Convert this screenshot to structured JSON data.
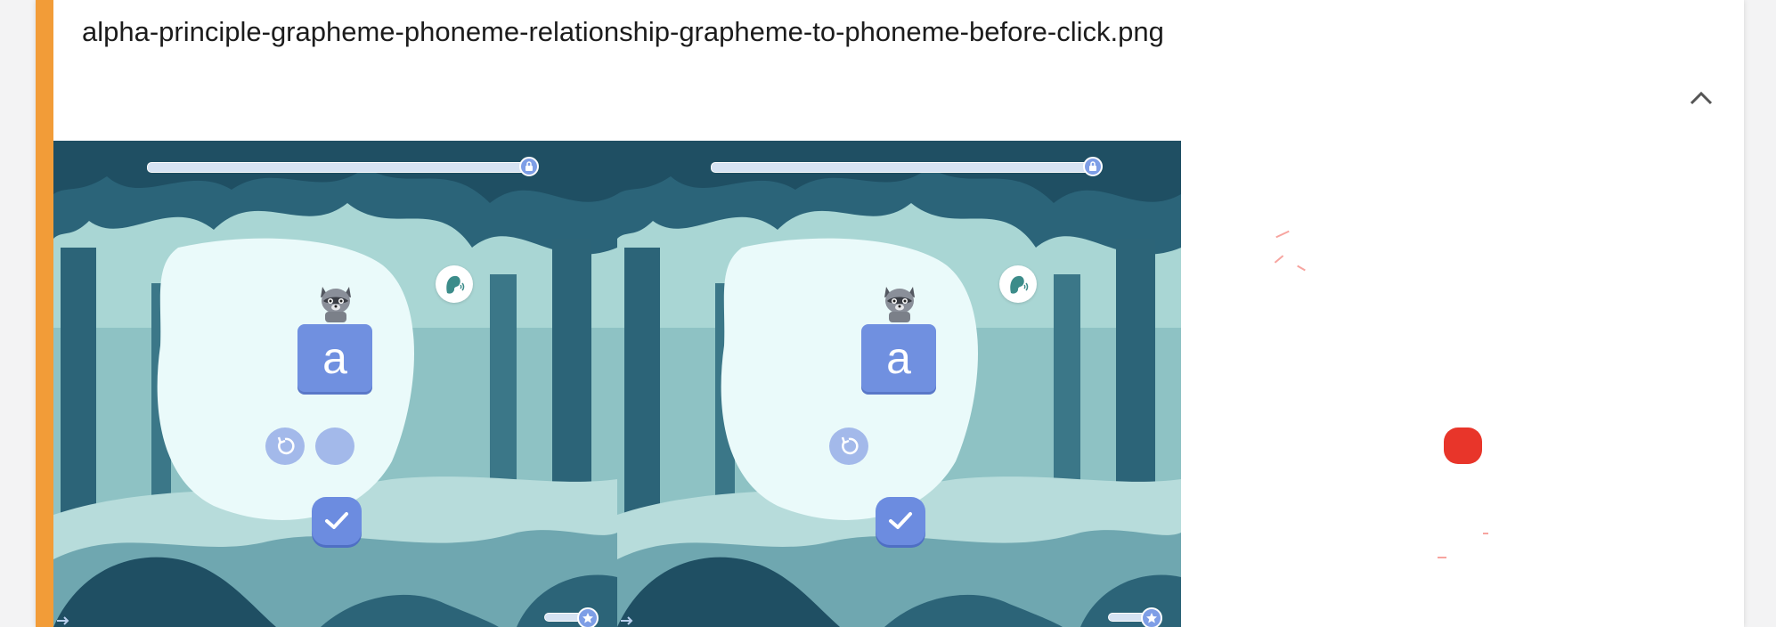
{
  "file": {
    "name": "alpha-principle-grapheme-phoneme-relationship-grapheme-to-phoneme-before-click.png"
  },
  "colors": {
    "accent": "#f29c38",
    "card": "#ffffff",
    "forest_dark": "#1f4f63",
    "forest_mid": "#3b7788",
    "bubble": "#eafafa",
    "tile": "#7090e0",
    "button": "#6c8ce0",
    "red_marker": "#e8352a"
  },
  "icons": {
    "collapse": "chevron-up-icon",
    "lock": "lock-icon",
    "speaker": "speaker-icon",
    "replay": "replay-icon",
    "check": "checkmark-icon",
    "star": "star-icon",
    "exit": "exit-icon"
  },
  "frames": [
    {
      "id": "before",
      "letter": "a",
      "progress": 0.0,
      "stars_progress": 0.0,
      "has_empty_button": true
    },
    {
      "id": "after",
      "letter": "a",
      "progress": 0.0,
      "stars_progress": 0.0,
      "has_empty_button": false
    }
  ]
}
